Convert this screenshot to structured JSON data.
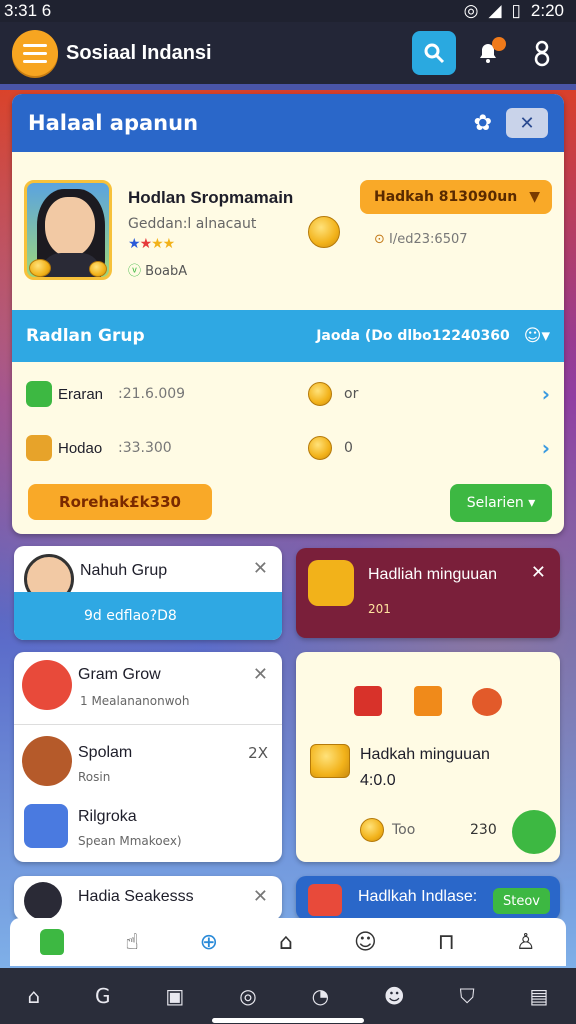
{
  "status": {
    "time_left": "3:31 6",
    "time_right": "2:20"
  },
  "app": {
    "title": "Sosiaal Indansi"
  },
  "main": {
    "header": "Halaal apanun",
    "profile": {
      "name": "Hodlan Sropmamain",
      "subtitle": "Geddan:l alnacaut",
      "badge": "BoabA",
      "reward": "Hadkah 813090un",
      "id": "I/ed23:6507"
    },
    "group": {
      "label": "Radlan Grup",
      "right": "Jaoda (Do dlbo12240360"
    },
    "rows": [
      {
        "label": "Eraran",
        "value": ":21.6.009",
        "extra": "or"
      },
      {
        "label": "Hodao",
        "value": ":33.300",
        "extra": "0"
      }
    ],
    "bonus": "Rorehak£k330",
    "button": "Selarien"
  },
  "cards": {
    "c1": {
      "title": "Nahuh Grup",
      "sub": "9d edflao?D8"
    },
    "c2": {
      "title": "Hadliah minguuan",
      "sub": "201"
    },
    "c3": {
      "items": [
        {
          "title": "Gram Grow",
          "sub": "1 Mealananonwoh"
        },
        {
          "title": "Spolam",
          "sub": "Rosin",
          "extra": "2X"
        },
        {
          "title": "Rilgroka",
          "sub": "Spean Mmakoex)"
        }
      ]
    },
    "c4": {
      "title": "Hadkah minguuan",
      "value": "4:0.0",
      "left": "Too",
      "right": "230"
    },
    "c5": {
      "title": "Hadia Seakesss"
    },
    "c6": {
      "title": "Hadlkah Indlase:",
      "button": "Steov"
    }
  }
}
